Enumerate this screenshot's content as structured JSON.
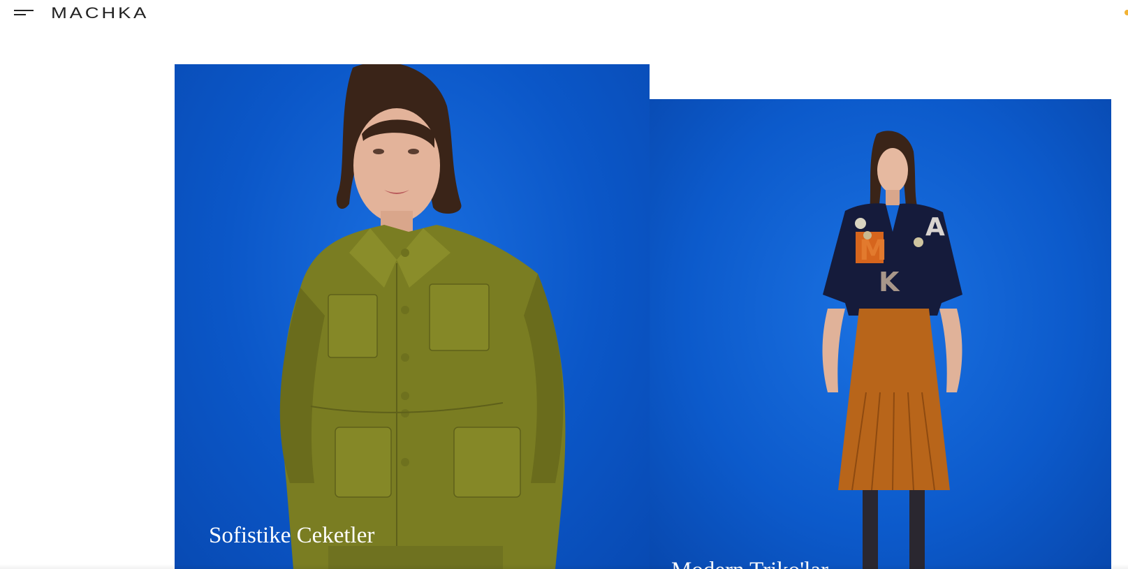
{
  "header": {
    "menu_icon": "hamburger-menu-icon",
    "logo_text": "MACHKA"
  },
  "tiles": [
    {
      "caption": "Sofistike Ceketler",
      "background_color": "#0b57c8",
      "garment_color": "#7a7d22"
    },
    {
      "caption": "Modern Triko'lar",
      "background_color": "#0c5acb",
      "top_color": "#151b3b",
      "skirt_color": "#b8651a"
    }
  ],
  "colors": {
    "accent_dot": "#f2b233",
    "text_dark": "#222222"
  }
}
